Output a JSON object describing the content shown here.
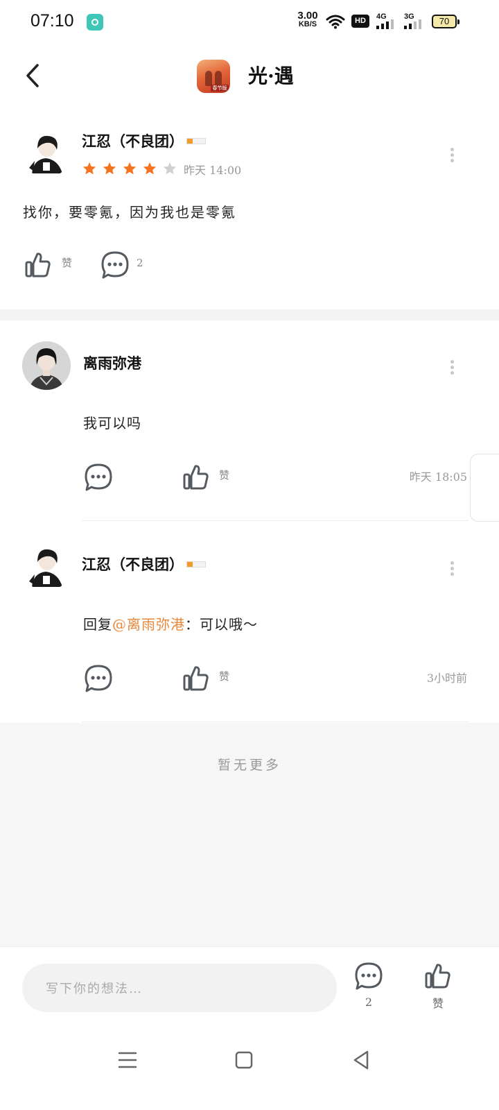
{
  "status_bar": {
    "time": "07:10",
    "net_speed_value": "3.00",
    "net_speed_unit": "KB/S",
    "hd_label": "HD",
    "signal1_label": "4G",
    "signal2_label": "3G",
    "battery": "70"
  },
  "header": {
    "title": "光·遇",
    "game_icon_tag": "春节版"
  },
  "post": {
    "username": "江忍（不良团）",
    "rating": 4,
    "rating_max": 5,
    "time": "昨天 14:00",
    "content": "找你，要零氪，因为我也是零氪",
    "like_label": "赞",
    "comment_count": "2"
  },
  "comments": [
    {
      "username": "离雨弥港",
      "text": "我可以吗",
      "like_label": "赞",
      "time": "昨天 18:05"
    },
    {
      "username": "江忍（不良团）",
      "reply_prefix": "回复",
      "mention": "@离雨弥港",
      "reply_text": "：可以哦～",
      "like_label": "赞",
      "time": "3小时前"
    }
  ],
  "empty_text": "暂无更多",
  "bottom_bar": {
    "input_placeholder": "写下你的想法…",
    "comment_count": "2",
    "like_label": "赞"
  },
  "colors": {
    "accent_orange": "#f5731e",
    "mention_orange": "#e8873a",
    "icon_gray": "#555a60",
    "star_empty": "#d0d0d0"
  }
}
